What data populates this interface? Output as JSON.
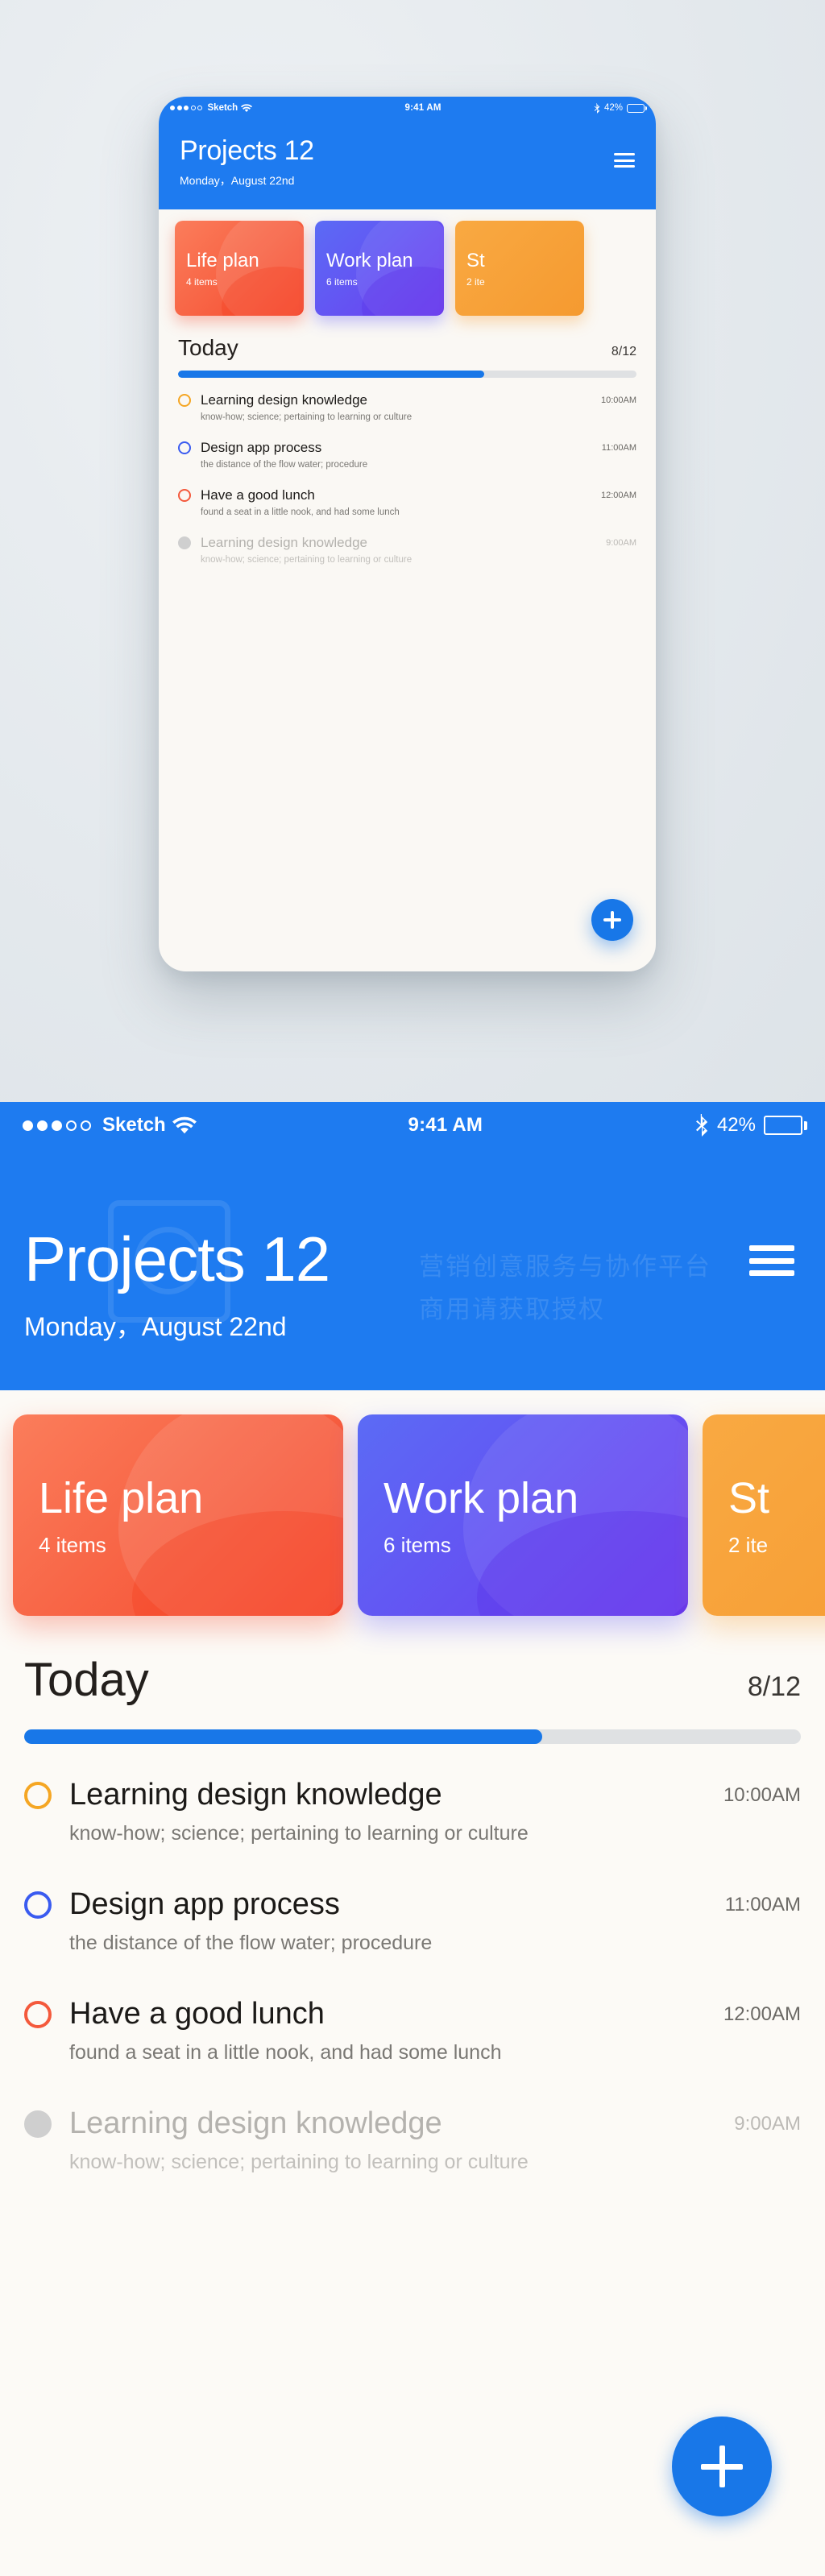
{
  "status_bar": {
    "carrier": "Sketch",
    "signal_dots_filled": 3,
    "signal_dots_total": 5,
    "wifi_icon": "wifi-icon",
    "time": "9:41 AM",
    "bluetooth_icon": "bluetooth-icon",
    "battery_percent": "42%",
    "battery_level": 42
  },
  "header": {
    "title": "Projects 12",
    "subtitle": "Monday，August 22nd",
    "menu_icon": "hamburger-menu-icon",
    "background_color": "#1E7BF0"
  },
  "watermark": {
    "line1": "营销创意服务与协作平台",
    "line2": "商用请获取授权"
  },
  "plan_cards": [
    {
      "name": "Life plan",
      "count": "4 items",
      "color_from": "#FB7D5B",
      "color_to": "#F4492D"
    },
    {
      "name": "Work plan",
      "count": "6 items",
      "color_from": "#5B6BF5",
      "color_to": "#6D3CF0"
    },
    {
      "name": "St",
      "count": "2 ite",
      "color_from": "#F9A942",
      "color_to": "#F59A30"
    }
  ],
  "today": {
    "label": "Today",
    "count": "8/12",
    "progress_done": 8,
    "progress_total": 12,
    "progress_percent": 66.7,
    "progress_color": "#1877E8",
    "track_color": "#DFE1E3"
  },
  "tasks": [
    {
      "title": "Learning design knowledge",
      "time": "10:00AM",
      "description": "know-how; science; pertaining to learning or culture",
      "ring_color": "#F5A623",
      "completed": false
    },
    {
      "title": "Design app process",
      "time": "11:00AM",
      "description": "the distance of the flow water; procedure",
      "ring_color": "#3A5BF0",
      "completed": false
    },
    {
      "title": "Have a good lunch",
      "time": "12:00AM",
      "description": " found a seat in a little nook, and had some lunch",
      "ring_color": "#F4593C",
      "completed": false
    },
    {
      "title": "Learning design knowledge",
      "time": "9:00AM",
      "description": "know-how; science; pertaining to learning or culture",
      "ring_color": "#CFCFCF",
      "completed": true
    }
  ],
  "fab": {
    "icon": "plus-icon",
    "color": "#1877E8"
  }
}
